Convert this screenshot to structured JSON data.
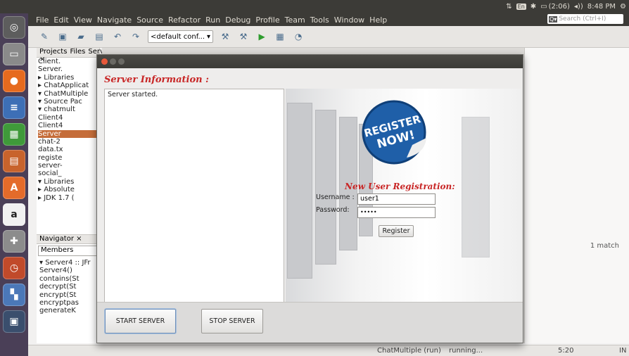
{
  "topbar": {
    "battery": "(2:06)",
    "clock": "8:48 PM",
    "keyboard": "En"
  },
  "menubar": {
    "items": [
      "File",
      "Edit",
      "View",
      "Navigate",
      "Source",
      "Refactor",
      "Run",
      "Debug",
      "Profile",
      "Team",
      "Tools",
      "Window",
      "Help"
    ],
    "search_placeholder": "Search (Ctrl+I)"
  },
  "toolbar": {
    "config_value": "<default conf..."
  },
  "left_panel": {
    "tabs": [
      "Projects ×",
      "Files",
      "Services"
    ],
    "tree": [
      "Client.",
      "Server.",
      "▸ Libraries",
      "▸ ChatApplicat",
      "▾ ChatMultiple",
      "  ▾ Source Pac",
      "    ▾ chatmult",
      "      Client4",
      "      Client4",
      "      Server",
      "      chat-2",
      "      data.tx",
      "      registe",
      "      server-",
      "      social_",
      "  ▾ Libraries",
      "    ▸ Absolute",
      "    ▸ JDK 1.7 ("
    ]
  },
  "navigator": {
    "header": "Navigator ×",
    "filter": "Members",
    "items": [
      "▾ Server4 :: JFr",
      "  Server4()",
      "  contains(St",
      "  decrypt(St",
      "  encrypt(St",
      "  encryptpas",
      "  generateK"
    ]
  },
  "right_panel": {
    "match_text": "1 match"
  },
  "statusbar": {
    "project": "ChatMultiple (run)",
    "state": "running...",
    "position": "5:20",
    "mode": "IN"
  },
  "dialog": {
    "info_title": "Server Information :",
    "log_text": "Server started.",
    "badge_line1": "REGISTER",
    "badge_line2": "NOW!",
    "reg_title": "New User Registration:",
    "username_label": "Username :",
    "username_value": "user1",
    "password_label": "Password:",
    "password_value": "•••••",
    "register_label": "Register",
    "start_label": "START SERVER",
    "stop_label": "STOP SERVER"
  },
  "colors": {
    "accent_red": "#c82626",
    "badge_blue": "#1f5fa8",
    "launcher": "#4a3f57",
    "selection": "#c56d3a"
  }
}
